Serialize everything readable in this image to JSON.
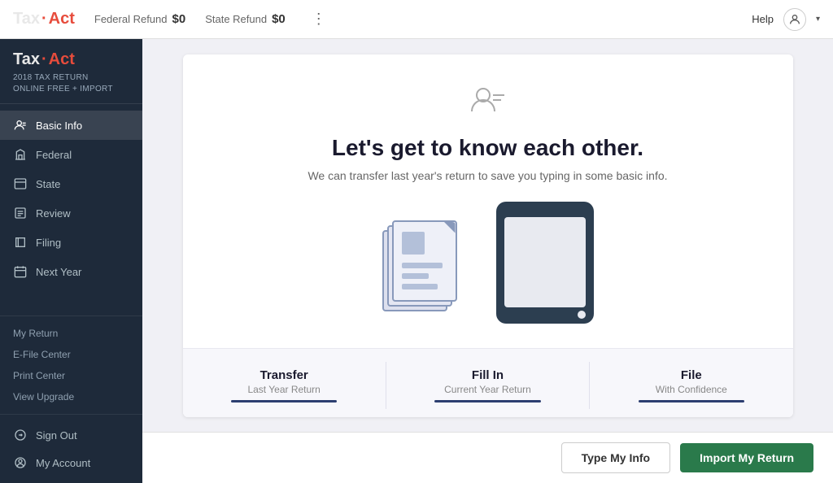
{
  "header": {
    "federal_refund_label": "Federal Refund",
    "federal_refund_value": "$0",
    "state_refund_label": "State Refund",
    "state_refund_value": "$0",
    "help_label": "Help"
  },
  "logo": {
    "tax": "Tax",
    "act": "Act",
    "subtitle_line1": "2018 TAX RETURN",
    "subtitle_line2": "ONLINE FREE + IMPORT"
  },
  "nav": {
    "items": [
      {
        "label": "Basic Info",
        "active": true
      },
      {
        "label": "Federal",
        "active": false
      },
      {
        "label": "State",
        "active": false
      },
      {
        "label": "Review",
        "active": false
      },
      {
        "label": "Filing",
        "active": false
      },
      {
        "label": "Next Year",
        "active": false
      }
    ],
    "secondary_items": [
      {
        "label": "My Return"
      },
      {
        "label": "E-File Center"
      },
      {
        "label": "Print Center"
      },
      {
        "label": "View Upgrade"
      }
    ],
    "bottom_items": [
      {
        "label": "Sign Out"
      },
      {
        "label": "My Account"
      }
    ]
  },
  "card": {
    "title": "Let's get to know each other.",
    "subtitle": "We can transfer last year's return to save you typing in some basic info.",
    "steps": [
      {
        "title": "Transfer",
        "desc": "Last Year Return"
      },
      {
        "title": "Fill In",
        "desc": "Current Year Return"
      },
      {
        "title": "File",
        "desc": "With Confidence"
      }
    ]
  },
  "footer": {
    "type_info_label": "Type My Info",
    "import_return_label": "Import My Return"
  }
}
